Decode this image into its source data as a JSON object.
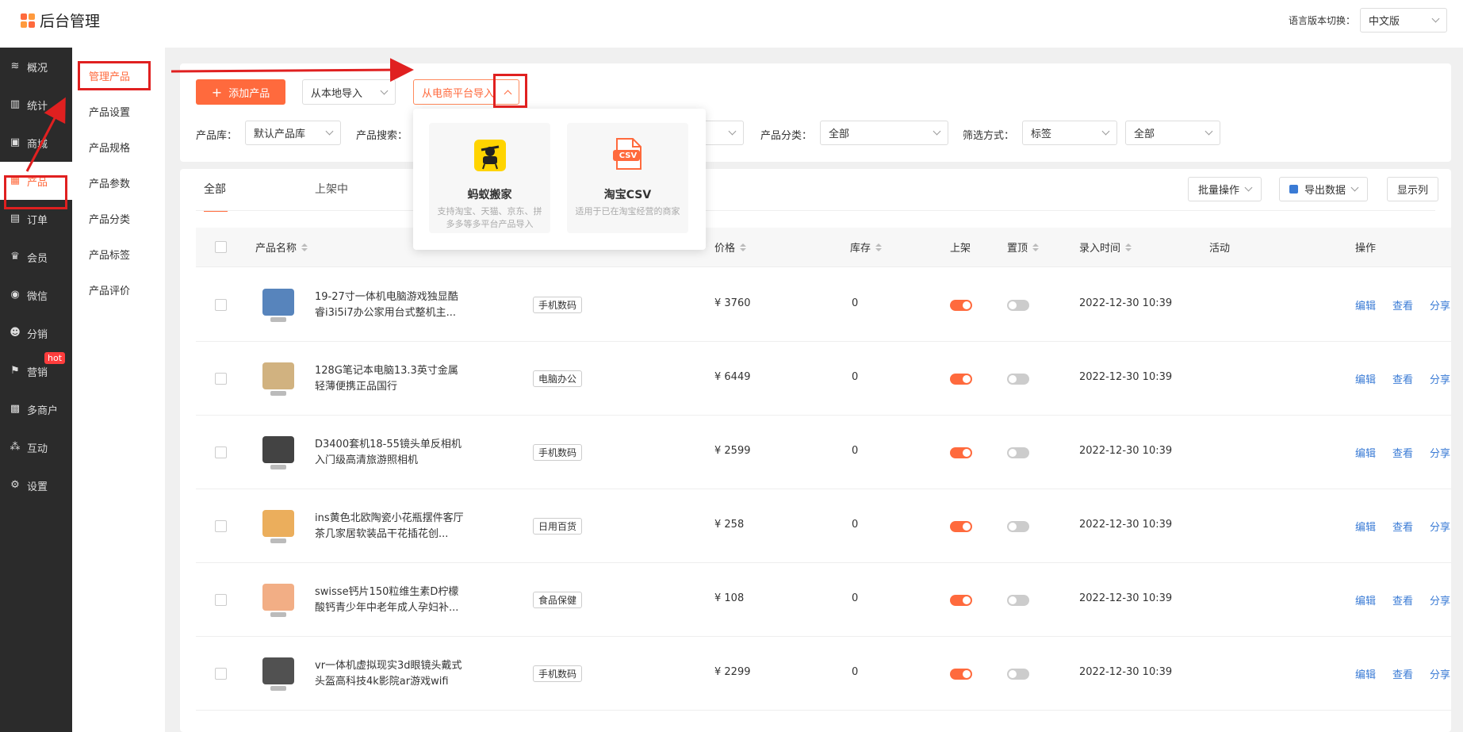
{
  "app": {
    "title": "后台管理"
  },
  "lang": {
    "label": "语言版本切换：",
    "value": "中文版"
  },
  "sidebar": {
    "items": [
      {
        "label": "概况",
        "icon": "layers-icon"
      },
      {
        "label": "统计",
        "icon": "chart-icon"
      },
      {
        "label": "商城",
        "icon": "store-icon"
      },
      {
        "label": "产品",
        "icon": "grid-icon"
      },
      {
        "label": "订单",
        "icon": "clipboard-icon"
      },
      {
        "label": "会员",
        "icon": "crown-icon"
      },
      {
        "label": "微信",
        "icon": "wechat-icon"
      },
      {
        "label": "分销",
        "icon": "share-user-icon"
      },
      {
        "label": "营销",
        "icon": "flag-icon",
        "badge": "hot"
      },
      {
        "label": "多商户",
        "icon": "multi-store-icon"
      },
      {
        "label": "互动",
        "icon": "interact-icon"
      },
      {
        "label": "设置",
        "icon": "gear-icon"
      }
    ]
  },
  "subnav": {
    "items": [
      "管理产品",
      "产品设置",
      "产品规格",
      "产品参数",
      "产品分类",
      "产品标签",
      "产品评价"
    ]
  },
  "toolbar": {
    "add": "添加产品",
    "local_import": "从本地导入",
    "platform_import": "从电商平台导入"
  },
  "filters": {
    "lib_label": "产品库：",
    "lib_value": "默认产品库",
    "search_label": "产品搜索：",
    "cat_label": "产品分类：",
    "cat_value": "全部",
    "mode_label": "筛选方式：",
    "mode_value": "标签",
    "mode_value2": "全部"
  },
  "dropdown": {
    "cards": [
      {
        "title": "蚂蚁搬家",
        "desc": "支持淘宝、天猫、京东、拼多多等多平台产品导入"
      },
      {
        "title": "淘宝CSV",
        "desc": "适用于已在淘宝经营的商家",
        "badge": "CSV"
      }
    ]
  },
  "tabs": [
    "全部",
    "上架中"
  ],
  "actions": {
    "batch": "批量操作",
    "export": "导出数据",
    "columns": "显示列"
  },
  "table": {
    "headers": {
      "name": "产品名称",
      "price": "价格",
      "stock": "库存",
      "onsale": "上架",
      "top": "置顶",
      "time": "录入时间",
      "activity": "活动",
      "ops": "操作"
    },
    "ops": [
      "编辑",
      "查看",
      "分享"
    ],
    "rows": [
      {
        "name": "19-27寸一体机电脑游戏独显酷睿i3i5i7办公家用台式整机主...",
        "category": "手机数码",
        "price": "¥ 3760",
        "stock": "0",
        "time": "2022-12-30 10:39",
        "onsale": true,
        "top": false
      },
      {
        "name": "128G笔记本电脑13.3英寸金属轻薄便携正品国行",
        "category": "电脑办公",
        "price": "¥ 6449",
        "stock": "0",
        "time": "2022-12-30 10:39",
        "onsale": true,
        "top": false
      },
      {
        "name": "D3400套机18-55镜头单反相机入门级高清旅游照相机",
        "category": "手机数码",
        "price": "¥ 2599",
        "stock": "0",
        "time": "2022-12-30 10:39",
        "onsale": true,
        "top": false
      },
      {
        "name": "ins黄色北欧陶瓷小花瓶摆件客厅茶几家居软装品干花插花创...",
        "category": "日用百货",
        "price": "¥ 258",
        "stock": "0",
        "time": "2022-12-30 10:39",
        "onsale": true,
        "top": false
      },
      {
        "name": "swisse钙片150粒维生素D柠檬酸钙青少年中老年成人孕妇补...",
        "category": "食品保健",
        "price": "¥ 108",
        "stock": "0",
        "time": "2022-12-30 10:39",
        "onsale": true,
        "top": false
      },
      {
        "name": "vr一体机虚拟现实3d眼镜头戴式头盔高科技4k影院ar游戏wifi",
        "category": "手机数码",
        "price": "¥ 2299",
        "stock": "0",
        "time": "2022-12-30 10:39",
        "onsale": true,
        "top": false
      }
    ]
  },
  "colors": {
    "accent": "#ff6a3d",
    "sidebar": "#2b2b2b",
    "annotation": "#e02020",
    "link": "#3a7bd5"
  }
}
